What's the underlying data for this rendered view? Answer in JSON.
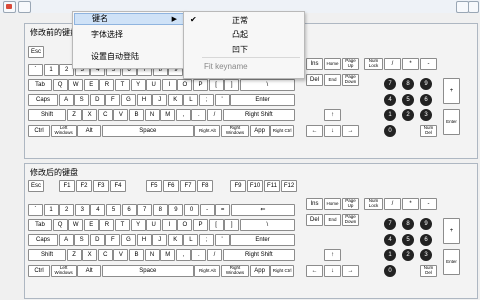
{
  "menu": {
    "items": [
      {
        "label": "键名"
      },
      {
        "label": "字体选择"
      },
      {
        "label": "设置自动登陆"
      }
    ]
  },
  "submenu": {
    "checkmark": "✔",
    "items": [
      {
        "label": "正常"
      },
      {
        "label": "凸起"
      },
      {
        "label": "凹下"
      }
    ],
    "hint": "Fit keyname"
  },
  "keyboards": {
    "before": {
      "title": "修改前的键盘"
    },
    "after": {
      "title": "修改后的键盘"
    }
  },
  "keys": {
    "esc": "Esc",
    "f": [
      "F1",
      "F2",
      "F3",
      "F4",
      "F5",
      "F6",
      "F7",
      "F8",
      "F9",
      "F10",
      "F11",
      "F12"
    ],
    "number_row": [
      "`",
      "1",
      "2",
      "3",
      "4",
      "5",
      "6",
      "7",
      "8",
      "9",
      "0",
      "-",
      "=",
      "⇐"
    ],
    "tab_row": [
      "Tab",
      "Q",
      "W",
      "E",
      "R",
      "T",
      "Y",
      "U",
      "I",
      "O",
      "P",
      "[",
      "]",
      "\\"
    ],
    "caps_row": [
      "Caps",
      "A",
      "S",
      "D",
      "F",
      "G",
      "H",
      "J",
      "K",
      "L",
      ";",
      "'",
      "Enter"
    ],
    "shift_row": [
      "Shift",
      "Z",
      "X",
      "C",
      "V",
      "B",
      "N",
      "M",
      ",",
      ".",
      "/",
      "Right Shift"
    ],
    "ctrl_row": [
      "Ctrl",
      "Left Windows",
      "Alt",
      "Space",
      "Right Alt",
      "Right Windows",
      "App",
      "Right Ctrl"
    ],
    "nav": [
      "Ins",
      "Home",
      "Page Up",
      "Del",
      "End",
      "Page Down"
    ],
    "arrows": {
      "up": "↑",
      "left": "←",
      "down": "↓",
      "right": "→"
    },
    "numpad_top": [
      "Num Lock",
      "/",
      "*",
      "-"
    ],
    "numpad_digits": [
      "7",
      "8",
      "9",
      "4",
      "5",
      "6",
      "1",
      "2",
      "3",
      "0"
    ],
    "numpad_plus": "+",
    "numpad_enter": "Enter",
    "numpad_del": "Num Del"
  }
}
